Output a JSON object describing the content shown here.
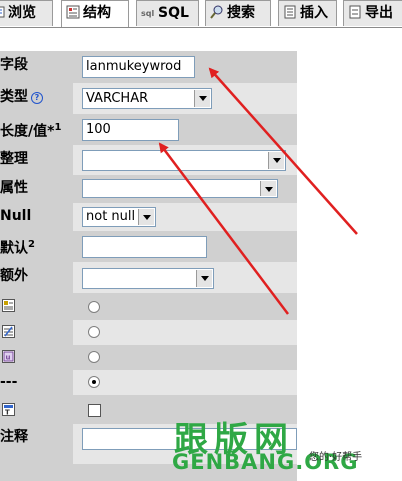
{
  "tabs": [
    {
      "label": "浏览",
      "icon": "browse-icon"
    },
    {
      "label": "结构",
      "icon": "structure-icon"
    },
    {
      "label": "SQL",
      "icon": "sql-icon"
    },
    {
      "label": "搜索",
      "icon": "search-icon"
    },
    {
      "label": "插入",
      "icon": "insert-icon"
    },
    {
      "label": "导出",
      "icon": "export-icon"
    }
  ],
  "form": {
    "field_label": "字段",
    "field_value": "lanmukeywrod",
    "type_label": "类型",
    "type_value": "VARCHAR",
    "length_label": "长度/值*",
    "length_sup": "1",
    "length_value": "100",
    "collation_label": "整理",
    "attributes_label": "属性",
    "null_label": "Null",
    "null_value": "not null",
    "default_label": "默认",
    "default_sup": "2",
    "extra_label": "额外",
    "index_none_label": "---",
    "comment_label": "注释"
  },
  "watermark": {
    "cn": "跟版网",
    "en": "GENBANG.ORG",
    "small": "您的·好帮手"
  },
  "colors": {
    "arrow": "#e02020",
    "watermark": "#2fa845"
  }
}
